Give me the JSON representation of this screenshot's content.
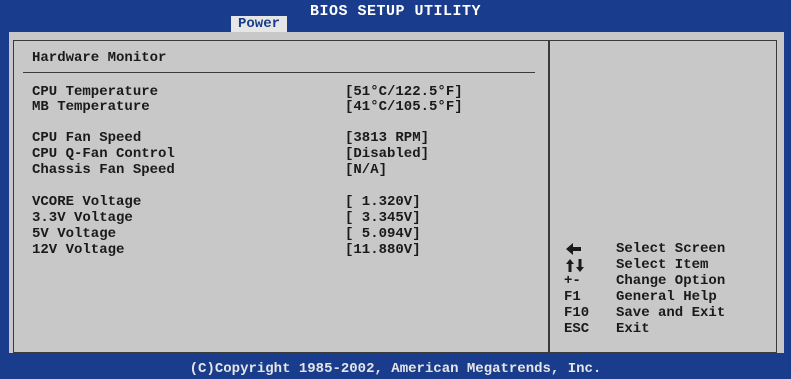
{
  "app_title": "BIOS SETUP UTILITY",
  "active_tab": "Power",
  "section_title": "Hardware Monitor",
  "monitor_rows": [
    {
      "label": "CPU Temperature",
      "value": "[51°C/122.5°F]"
    },
    {
      "label": "MB Temperature",
      "value": "[41°C/105.5°F]"
    },
    {
      "label": "CPU Fan Speed",
      "value": "[3813 RPM]"
    },
    {
      "label": "CPU Q-Fan Control",
      "value": "[Disabled]"
    },
    {
      "label": "Chassis Fan Speed",
      "value": "[N/A]"
    },
    {
      "label": "VCORE Voltage",
      "value": "[ 1.320V]"
    },
    {
      "label": "3.3V Voltage",
      "value": "[ 3.345V]"
    },
    {
      "label": "5V Voltage",
      "value": "[ 5.094V]"
    },
    {
      "label": "12V Voltage",
      "value": "[11.880V]"
    }
  ],
  "help": [
    {
      "key": "",
      "key_icon": "left-arrow-icon",
      "desc": "Select Screen"
    },
    {
      "key": "",
      "key_icon": "up-down-arrows-icon",
      "desc": "Select Item"
    },
    {
      "key": "+-",
      "desc": "Change Option"
    },
    {
      "key": "F1",
      "desc": "General Help"
    },
    {
      "key": "F10",
      "desc": "Save and Exit"
    },
    {
      "key": "ESC",
      "desc": "Exit"
    }
  ],
  "footer": "(C)Copyright 1985-2002, American Megatrends, Inc.",
  "colors": {
    "background": "#1a3c8c",
    "panel": "#c8c8c8",
    "text": "#1a1a1a",
    "header_text": "#ffffff"
  }
}
